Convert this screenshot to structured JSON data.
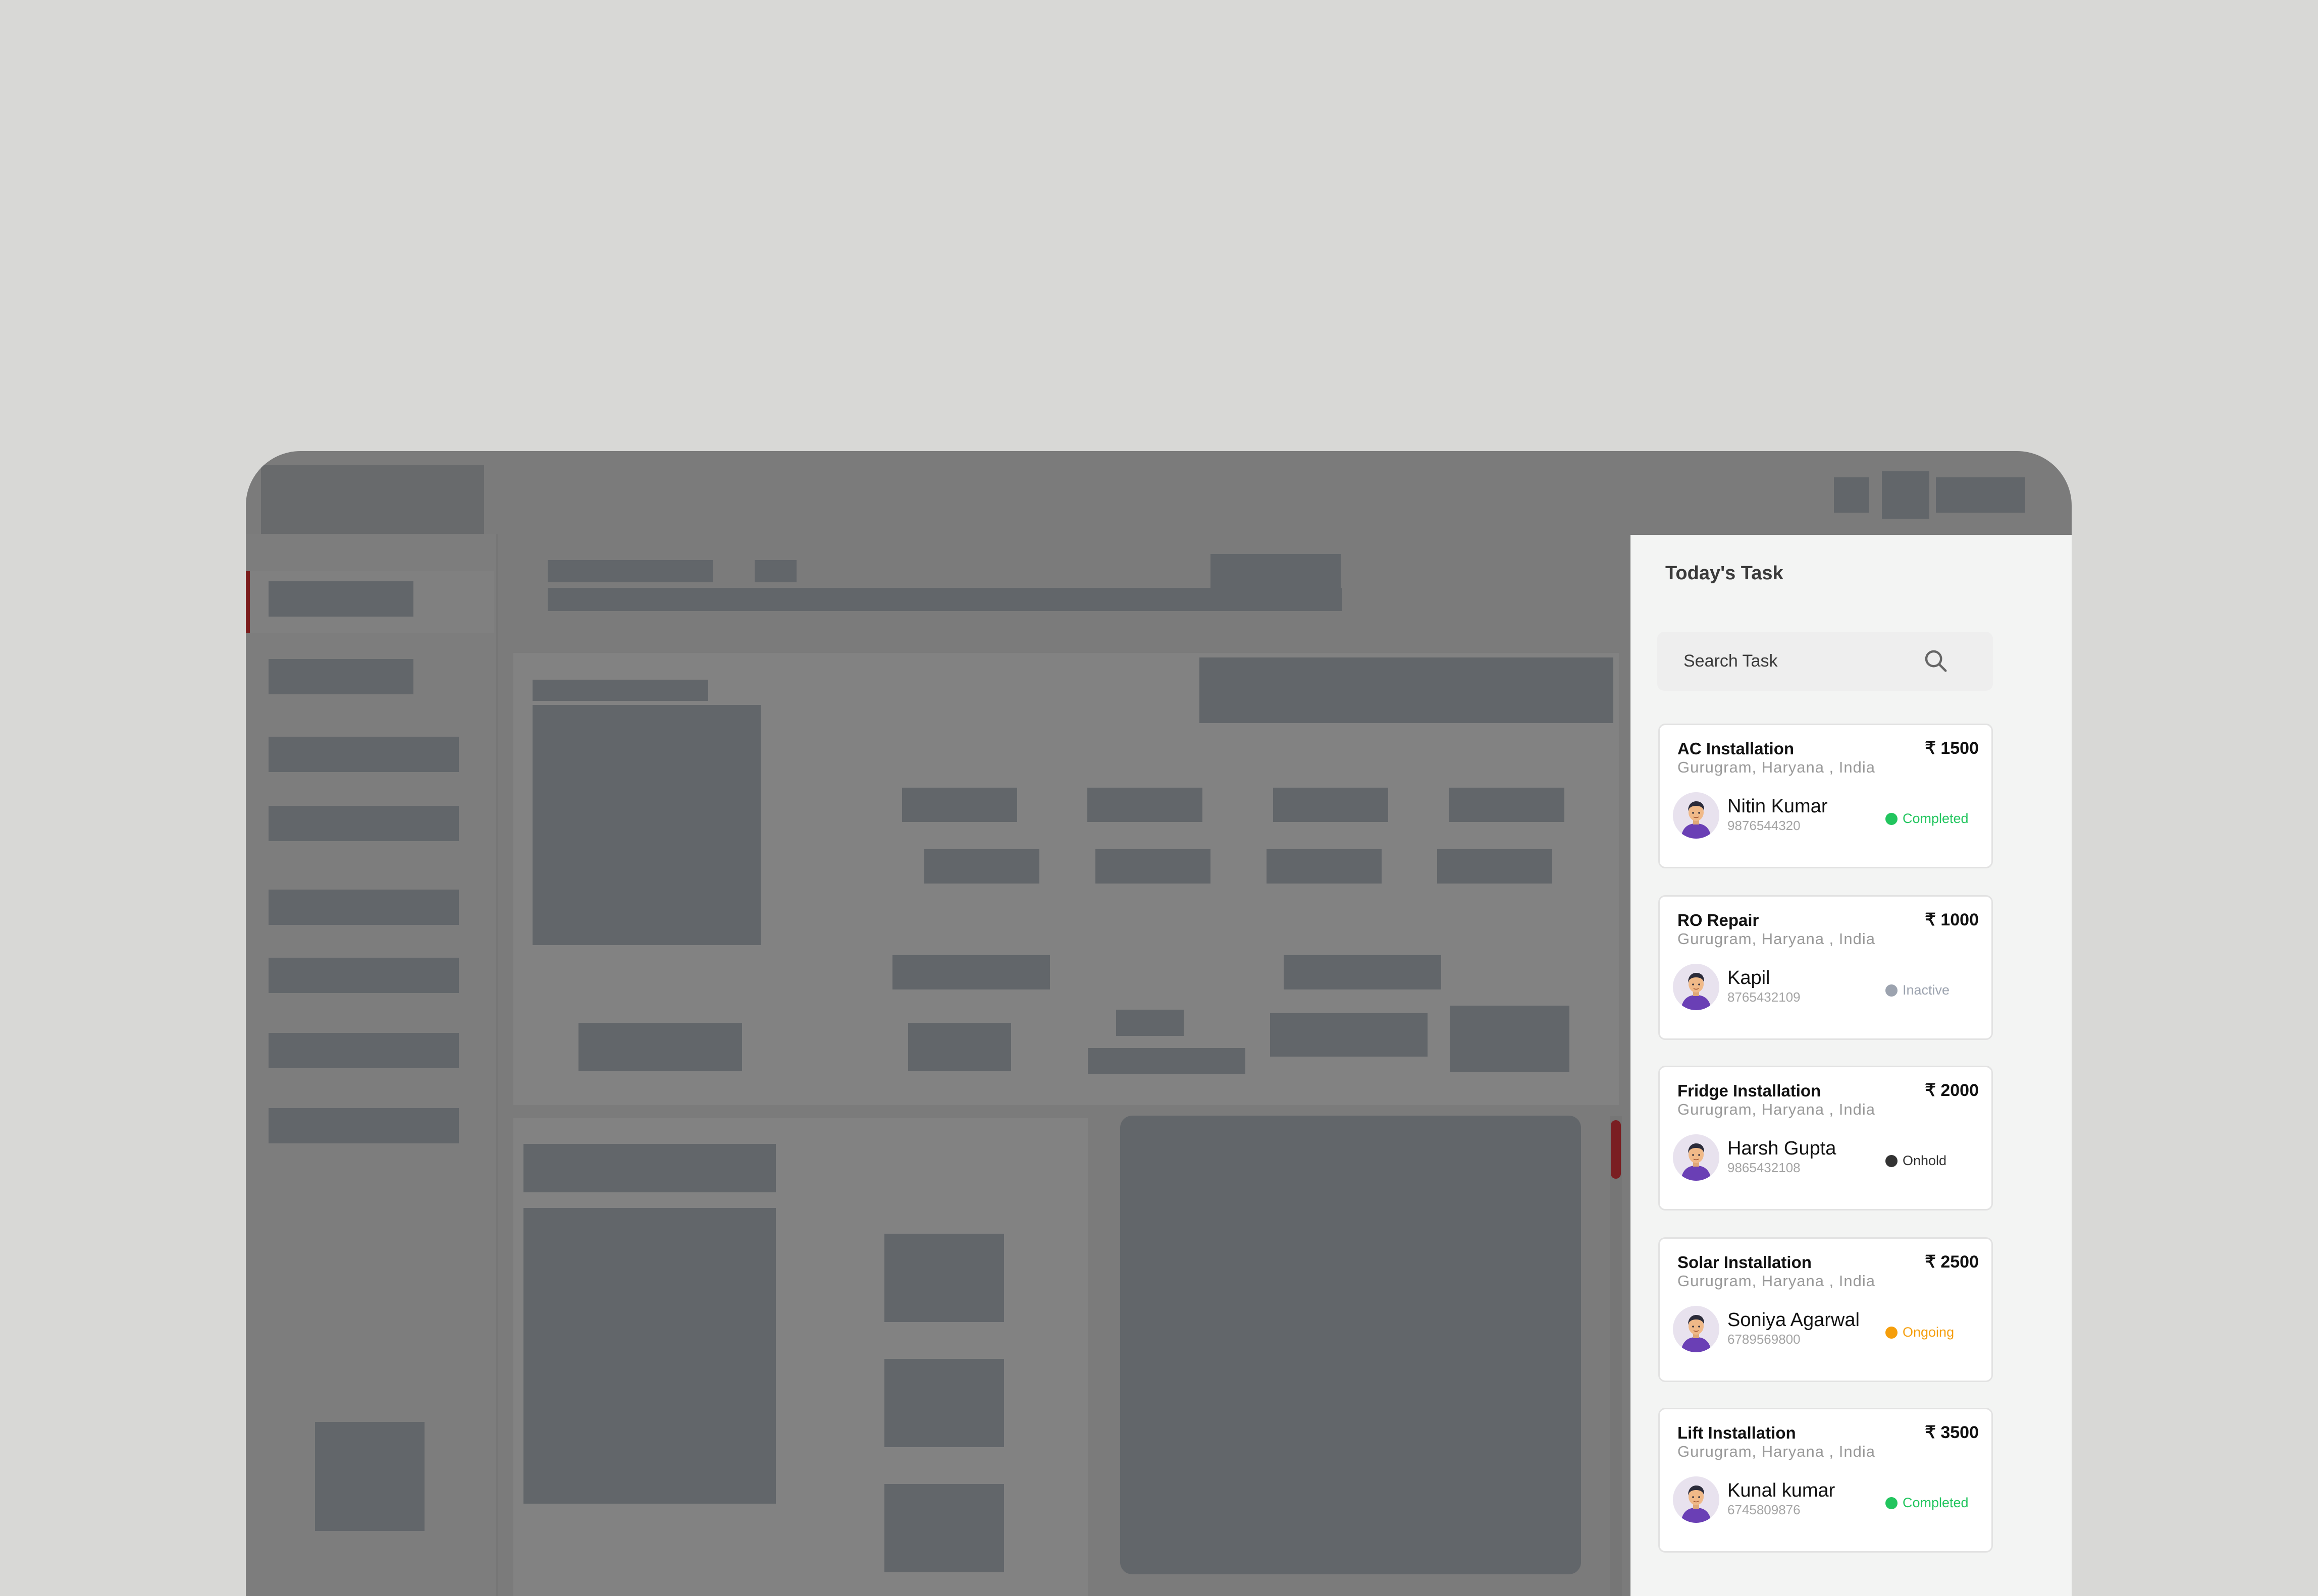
{
  "panel": {
    "title": "Today's Task",
    "search_placeholder": "Search Task"
  },
  "tasks": [
    {
      "title": "AC Installation",
      "price": "₹ 1500",
      "location": "Gurugram, Haryana , India",
      "name": "Nitin Kumar",
      "phone": "9876544320",
      "status": "Completed",
      "status_color": "#22c55e"
    },
    {
      "title": "RO Repair",
      "price": "₹ 1000",
      "location": "Gurugram, Haryana , India",
      "name": "Kapil",
      "phone": "8765432109",
      "status": "Inactive",
      "status_color": "#9ca3af"
    },
    {
      "title": "Fridge Installation",
      "price": "₹ 2000",
      "location": "Gurugram, Haryana , India",
      "name": "Harsh Gupta",
      "phone": "9865432108",
      "status": "Onhold",
      "status_color": "#333333"
    },
    {
      "title": "Solar Installation",
      "price": "₹ 2500",
      "location": "Gurugram, Haryana , India",
      "name": "Soniya Agarwal",
      "phone": "6789569800",
      "status": "Ongoing",
      "status_color": "#f59e0b"
    },
    {
      "title": "Lift Installation",
      "price": "₹ 3500",
      "location": "Gurugram, Haryana , India",
      "name": "Kunal kumar",
      "phone": "6745809876",
      "status": "Completed",
      "status_color": "#22c55e"
    }
  ]
}
